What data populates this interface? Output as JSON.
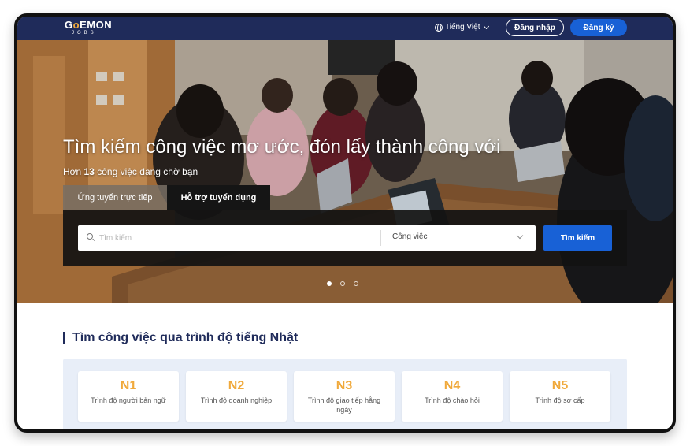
{
  "header": {
    "logo_main": "GOEMON",
    "logo_sub": "JOBS",
    "language": "Tiếng Việt",
    "login_label": "Đăng nhập",
    "register_label": "Đăng ký"
  },
  "hero": {
    "title": "Tìm kiếm công việc mơ ước, đón lấy thành công với",
    "subtitle_prefix": "Hơn ",
    "subtitle_count": "13",
    "subtitle_suffix": " công việc đang chờ bạn",
    "tabs": [
      {
        "label": "Ứng tuyển trực tiếp"
      },
      {
        "label": "Hỗ trợ tuyển dụng"
      }
    ],
    "search_placeholder": "Tìm kiếm",
    "category_value": "Công việc",
    "search_button": "Tìm kiếm",
    "carousel_active": 1,
    "carousel_count": 3
  },
  "levels_section": {
    "title": "Tìm công việc qua trình độ tiếng Nhật",
    "levels": [
      {
        "code": "N1",
        "desc": "Trình độ người bản ngữ"
      },
      {
        "code": "N2",
        "desc": "Trình độ doanh nghiệp"
      },
      {
        "code": "N3",
        "desc": "Trình độ giao tiếp hằng ngày"
      },
      {
        "code": "N4",
        "desc": "Trình độ chào hỏi"
      },
      {
        "code": "N5",
        "desc": "Trình độ sơ cấp"
      }
    ]
  },
  "colors": {
    "navy": "#1f2b5a",
    "accent_blue": "#1861d6",
    "level_orange": "#f0a93b",
    "panel_bg": "#e8eef8"
  }
}
